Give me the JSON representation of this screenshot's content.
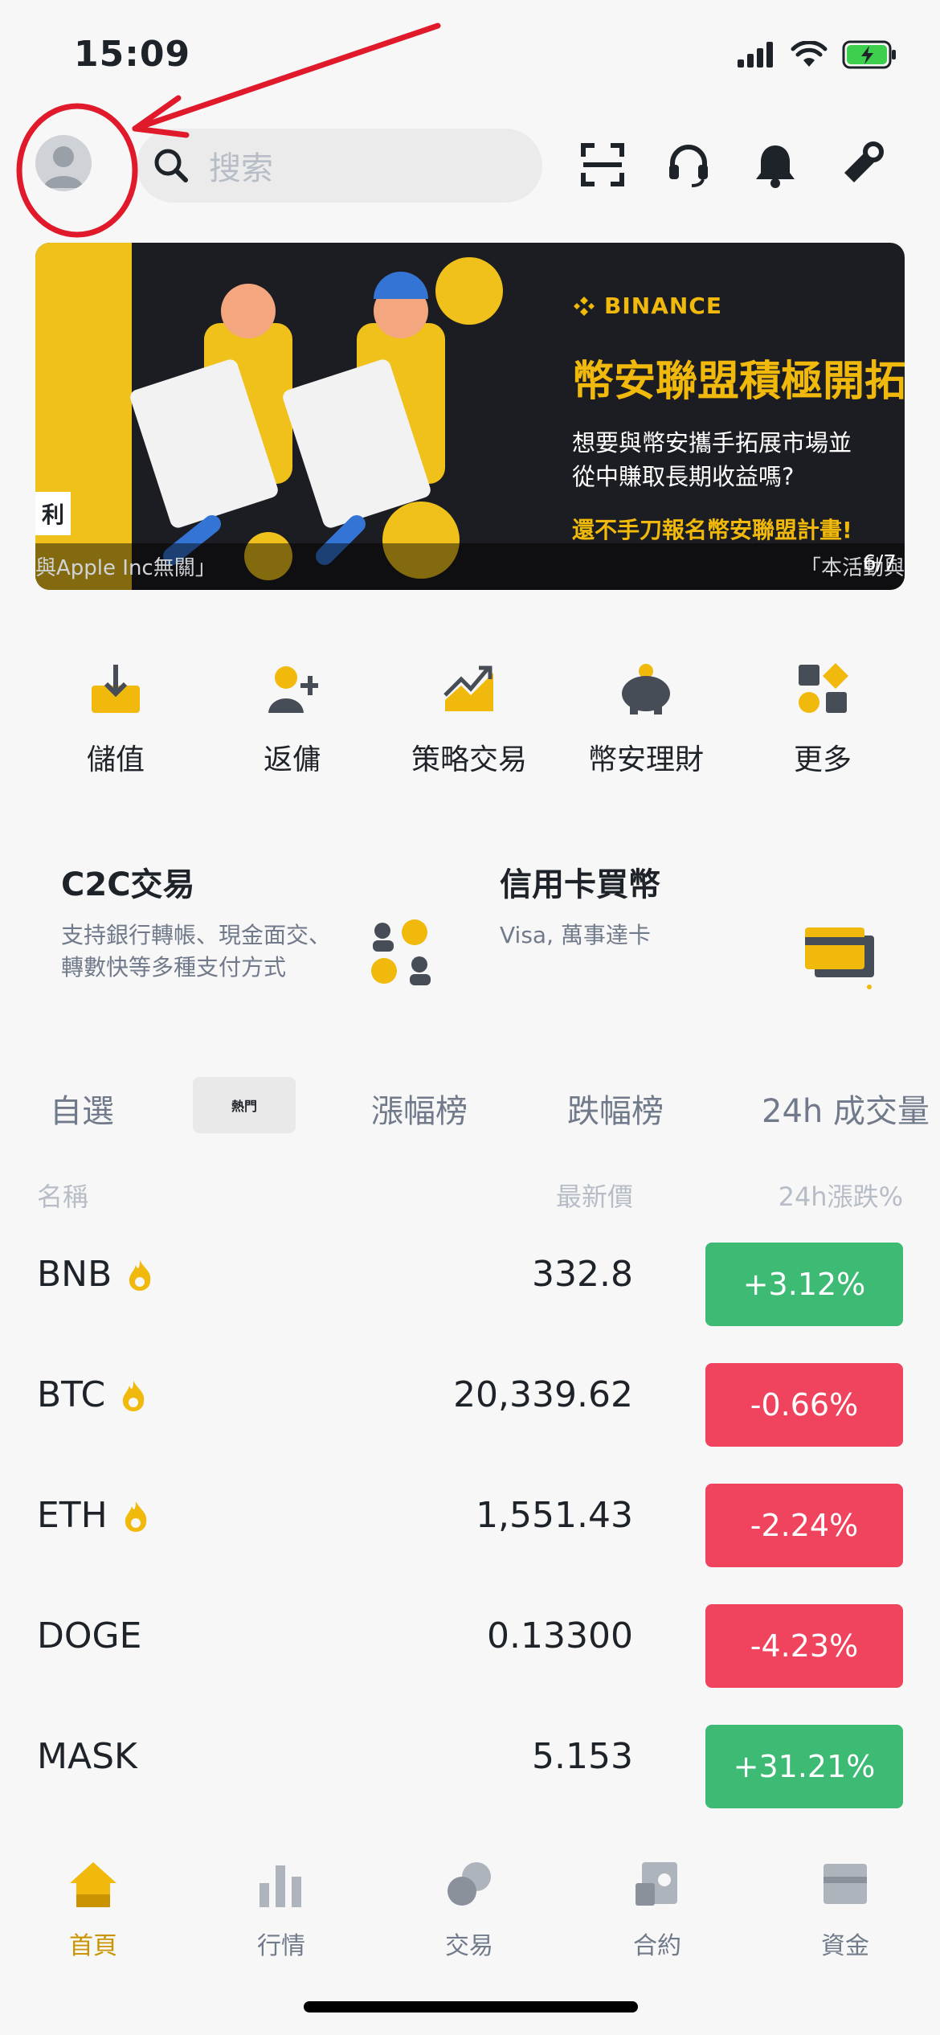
{
  "status_bar": {
    "time": "15:09"
  },
  "search": {
    "placeholder": "搜索"
  },
  "banner": {
    "brand": "BINANCE",
    "headline": "幣安聯盟積極開拓",
    "sub_line1": "想要與幣安攜手拓展市場並",
    "sub_line2": "從中賺取長期收益嗎?",
    "cta": "還不手刀報名幣安聯盟計畫!",
    "caption_left": "與Apple Inc無關」",
    "caption_right": "「本活動與",
    "pager": "6/7",
    "tag": "利"
  },
  "quick_menu": [
    {
      "label": "儲值",
      "icon": "deposit-icon"
    },
    {
      "label": "返傭",
      "icon": "referral-icon"
    },
    {
      "label": "策略交易",
      "icon": "strategy-trading-icon"
    },
    {
      "label": "幣安理財",
      "icon": "piggy-bank-icon"
    },
    {
      "label": "更多",
      "icon": "more-grid-icon"
    }
  ],
  "promos": {
    "c2c": {
      "title": "C2C交易",
      "desc_line1": "支持銀行轉帳、現金面交、",
      "desc_line2": "轉數快等多種支付方式"
    },
    "card": {
      "title": "信用卡買幣",
      "desc": "Visa, 萬事達卡"
    }
  },
  "tabs": [
    "自選",
    "熱門",
    "漲幅榜",
    "跌幅榜",
    "24h 成交量"
  ],
  "table": {
    "headers": {
      "name": "名稱",
      "price": "最新價",
      "change": "24h漲跌%"
    },
    "rows": [
      {
        "symbol": "BNB",
        "price": "332.8",
        "change": "+3.12%",
        "trend": "up",
        "hot": true
      },
      {
        "symbol": "BTC",
        "price": "20,339.62",
        "change": "-0.66%",
        "trend": "down",
        "hot": true
      },
      {
        "symbol": "ETH",
        "price": "1,551.43",
        "change": "-2.24%",
        "trend": "down",
        "hot": true
      },
      {
        "symbol": "DOGE",
        "price": "0.13300",
        "change": "-4.23%",
        "trend": "down",
        "hot": false
      },
      {
        "symbol": "MASK",
        "price": "5.153",
        "change": "+31.21%",
        "trend": "up",
        "hot": false
      }
    ]
  },
  "bottom_nav": [
    {
      "label": "首頁",
      "icon": "home-icon",
      "active": true
    },
    {
      "label": "行情",
      "icon": "markets-icon",
      "active": false
    },
    {
      "label": "交易",
      "icon": "trade-icon",
      "active": false
    },
    {
      "label": "合約",
      "icon": "futures-icon",
      "active": false
    },
    {
      "label": "資金",
      "icon": "wallet-icon",
      "active": false
    }
  ],
  "colors": {
    "brand": "#F0B90B",
    "up": "#3DBA74",
    "down": "#F0445E",
    "annotation": "#E0192B"
  }
}
